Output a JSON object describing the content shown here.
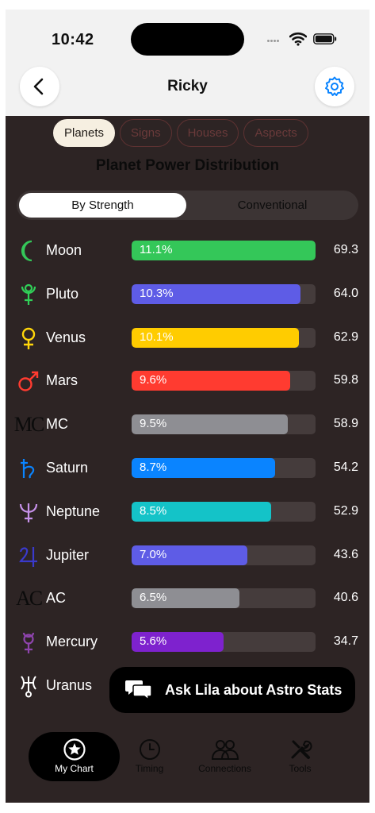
{
  "status": {
    "time": "10:42"
  },
  "header": {
    "title": "Ricky"
  },
  "tabs": [
    {
      "label": "Planets",
      "active": true
    },
    {
      "label": "Signs",
      "active": false
    },
    {
      "label": "Houses",
      "active": false
    },
    {
      "label": "Aspects",
      "active": false
    }
  ],
  "section": {
    "heading": "Planet Power Distribution"
  },
  "toggle": {
    "left": "By Strength",
    "right": "Conventional"
  },
  "planets": [
    {
      "name": "Moon",
      "glyph": "moon-icon",
      "percent": "11.1%",
      "score": "69.3",
      "fill": 1.0,
      "color": "#34c759"
    },
    {
      "name": "Pluto",
      "glyph": "pluto-icon",
      "percent": "10.3%",
      "score": "64.0",
      "fill": 0.92,
      "color": "#5e5ce6"
    },
    {
      "name": "Venus",
      "glyph": "venus-icon",
      "percent": "10.1%",
      "score": "62.9",
      "fill": 0.91,
      "color": "#ffcc00"
    },
    {
      "name": "Mars",
      "glyph": "mars-icon",
      "percent": "9.6%",
      "score": "59.8",
      "fill": 0.86,
      "color": "#ff3b30"
    },
    {
      "name": "MC",
      "glyph": "mc-icon",
      "percent": "9.5%",
      "score": "58.9",
      "fill": 0.85,
      "color": "#8e8e93"
    },
    {
      "name": "Saturn",
      "glyph": "saturn-icon",
      "percent": "8.7%",
      "score": "54.2",
      "fill": 0.78,
      "color": "#0a84ff"
    },
    {
      "name": "Neptune",
      "glyph": "neptune-icon",
      "percent": "8.5%",
      "score": "52.9",
      "fill": 0.76,
      "color": "#14c3c8"
    },
    {
      "name": "Jupiter",
      "glyph": "jupiter-icon",
      "percent": "7.0%",
      "score": "43.6",
      "fill": 0.63,
      "color": "#5e5ce6"
    },
    {
      "name": "AC",
      "glyph": "ac-icon",
      "percent": "6.5%",
      "score": "40.6",
      "fill": 0.585,
      "color": "#8e8e93"
    },
    {
      "name": "Mercury",
      "glyph": "mercury-icon",
      "percent": "5.6%",
      "score": "34.7",
      "fill": 0.5,
      "color": "#7e22ce"
    },
    {
      "name": "Uranus",
      "glyph": "uranus-icon",
      "percent": "",
      "score": "",
      "fill": 0,
      "color": "#8e8e93"
    }
  ],
  "glyph_colors": {
    "moon": "#34c759",
    "pluto": "#30d158",
    "venus": "#ffd60a",
    "mars": "#ff3b30",
    "mc": "#0b0b0b",
    "saturn": "#0a84ff",
    "neptune": "#c792ea",
    "jupiter": "#3a3acc",
    "ac": "#0b0b0b",
    "mercury": "#8e44ad",
    "uranus": "#ffffff"
  },
  "ask": {
    "label": "Ask Lila about Astro Stats"
  },
  "nav": [
    {
      "label": "My Chart",
      "icon": "star-circle-icon",
      "active": true
    },
    {
      "label": "Timing",
      "icon": "clock-icon",
      "active": false
    },
    {
      "label": "Connections",
      "icon": "people-icon",
      "active": false
    },
    {
      "label": "Tools",
      "icon": "tools-icon",
      "active": false
    }
  ]
}
